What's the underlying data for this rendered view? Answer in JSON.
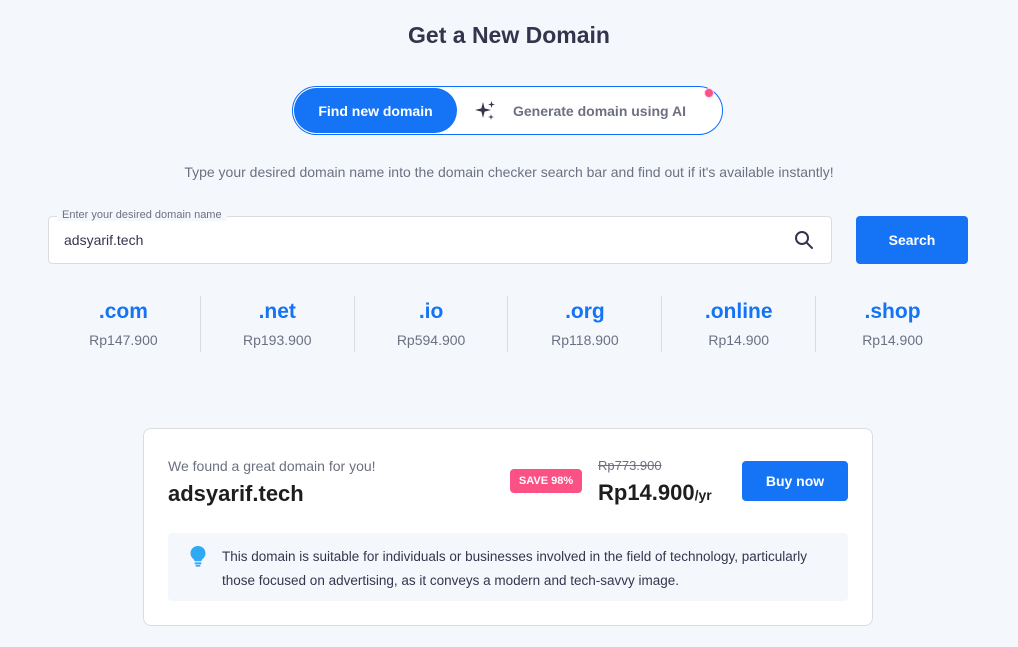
{
  "page": {
    "title": "Get a New Domain"
  },
  "toggle": {
    "active_label": "Find new domain",
    "ai_label": "Generate domain using AI",
    "ai_icon": "sparkles-icon"
  },
  "subtitle": "Type your desired domain name into the domain checker search bar and find out if it's available instantly!",
  "search": {
    "label": "Enter your desired domain name",
    "value": "adsyarif.tech",
    "button_label": "Search",
    "icon": "search-icon"
  },
  "tlds": [
    {
      "ext": ".com",
      "price": "Rp147.900"
    },
    {
      "ext": ".net",
      "price": "Rp193.900"
    },
    {
      "ext": ".io",
      "price": "Rp594.900"
    },
    {
      "ext": ".org",
      "price": "Rp118.900"
    },
    {
      "ext": ".online",
      "price": "Rp14.900"
    },
    {
      "ext": ".shop",
      "price": "Rp14.900"
    }
  ],
  "result": {
    "label": "We found a great domain for you!",
    "domain": "adsyarif.tech",
    "badge": "SAVE 98%",
    "old_price": "Rp773.900",
    "new_price": "Rp14.900",
    "per": "/yr",
    "buy_label": "Buy now",
    "tip_icon": "lightbulb-icon",
    "tip_text": "This domain is suitable for individuals or businesses involved in the field of technology, particularly those focused on advertising, as it conveys a modern and tech-savvy image."
  },
  "colors": {
    "accent": "#1474f5",
    "badge": "#fc5185",
    "background": "#f4f8fc"
  }
}
